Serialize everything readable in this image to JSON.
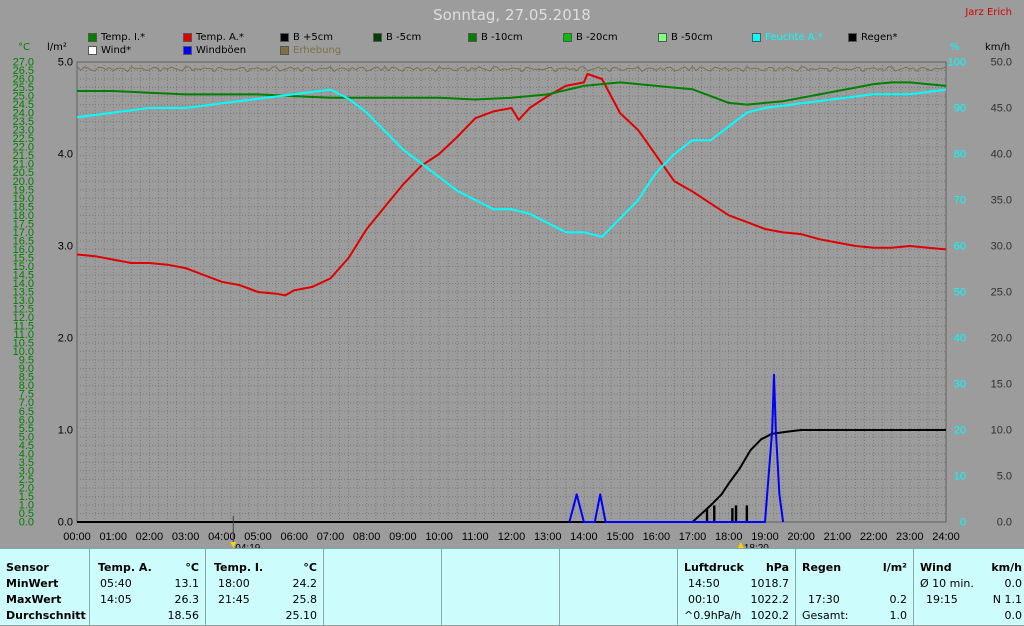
{
  "title": "Sonntag, 27.05.2018",
  "author": "Jarz Erich",
  "legend": [
    {
      "label": "Temp. I.*",
      "color": "#008000",
      "key": "temp_i"
    },
    {
      "label": "Temp. A.*",
      "color": "#e00000",
      "key": "temp_a"
    },
    {
      "label": "B +5cm",
      "color": "#000000",
      "key": "b5p"
    },
    {
      "label": "B -5cm",
      "color": "#004000",
      "key": "b5m"
    },
    {
      "label": "B -10cm",
      "color": "#008000",
      "key": "b10"
    },
    {
      "label": "B -20cm",
      "color": "#00c000",
      "key": "b20"
    },
    {
      "label": "B -50cm",
      "color": "#80ff80",
      "key": "b50"
    },
    {
      "label": "Feuchte A.*",
      "color": "#00ffff",
      "key": "humidity"
    },
    {
      "label": "Regen*",
      "color": "#000000",
      "key": "rain"
    },
    {
      "label": "Wind*",
      "color": "#ffffff",
      "key": "wind"
    },
    {
      "label": "Windböen",
      "color": "#0000ff",
      "key": "gust"
    },
    {
      "label": "Erhebung",
      "color": "#807048",
      "key": "erhebung"
    }
  ],
  "axis_units": {
    "left_temp": "°C",
    "left_rain": "l/m²",
    "right_hum": "%",
    "right_wind": "km/h"
  },
  "markers": {
    "sunrise": "04:19",
    "sunset": "18:20"
  },
  "colors": {
    "background": "#9c9c9c",
    "grid": "#7a7a7a",
    "panel": "#ccfcfc",
    "temp_left_axis": "#008000",
    "hum_axis": "#00ffff",
    "wind_axis": "#303030"
  },
  "chart_data": {
    "type": "line",
    "x_ticks": [
      "00:00",
      "01:00",
      "02:00",
      "03:00",
      "04:00",
      "05:00",
      "06:00",
      "07:00",
      "08:00",
      "09:00",
      "10:00",
      "11:00",
      "12:00",
      "13:00",
      "14:00",
      "15:00",
      "16:00",
      "17:00",
      "18:00",
      "19:00",
      "20:00",
      "21:00",
      "22:00",
      "23:00",
      "24:00"
    ],
    "xlim": [
      0,
      24
    ],
    "y_temp_ticks": [
      "0.0",
      "0.5",
      "1.0",
      "1.5",
      "2.0",
      "2.5",
      "3.0",
      "3.5",
      "4.0",
      "4.5",
      "5.0",
      "5.5",
      "6.0",
      "6.5",
      "7.0",
      "7.5",
      "8.0",
      "8.5",
      "9.0",
      "9.5",
      "10.0",
      "10.5",
      "11.0",
      "11.5",
      "12.0",
      "12.5",
      "13.0",
      "13.5",
      "14.0",
      "14.5",
      "15.0",
      "15.5",
      "16.0",
      "16.5",
      "17.0",
      "17.5",
      "18.0",
      "18.5",
      "19.0",
      "19.5",
      "20.0",
      "20.5",
      "21.0",
      "21.5",
      "22.0",
      "22.5",
      "23.0",
      "23.5",
      "24.0",
      "24.5",
      "25.0",
      "25.5",
      "26.0",
      "26.5",
      "27.0"
    ],
    "ylim_temp": [
      0,
      27
    ],
    "y_rain_ticks": [
      "0.0",
      "1.0",
      "2.0",
      "3.0",
      "4.0",
      "5.0"
    ],
    "ylim_rain": [
      0,
      5
    ],
    "y_hum_ticks": [
      "0",
      "10",
      "20",
      "30",
      "40",
      "50",
      "60",
      "70",
      "80",
      "90",
      "100"
    ],
    "ylim_hum": [
      0,
      100
    ],
    "y_wind_ticks": [
      "0.0",
      "5.0",
      "10.0",
      "15.0",
      "20.0",
      "25.0",
      "30.0",
      "35.0",
      "40.0",
      "45.0",
      "50.0"
    ],
    "ylim_wind": [
      0,
      50
    ],
    "series": [
      {
        "name": "Temp. A.*",
        "axis": "temp",
        "color": "#e00000",
        "x": [
          0,
          0.5,
          1,
          1.5,
          2,
          2.5,
          3,
          3.5,
          4,
          4.5,
          5,
          5.5,
          5.75,
          6,
          6.5,
          7,
          7.5,
          8,
          8.5,
          9,
          9.5,
          10,
          10.5,
          11,
          11.5,
          12,
          12.2,
          12.5,
          13,
          13.5,
          14,
          14.1,
          14.5,
          15,
          15.5,
          16,
          16.5,
          17,
          17.5,
          18,
          18.5,
          19,
          19.5,
          20,
          20.5,
          21,
          21.5,
          22,
          22.5,
          23,
          23.5,
          24
        ],
        "y": [
          15.7,
          15.6,
          15.4,
          15.2,
          15.2,
          15.1,
          14.9,
          14.5,
          14.1,
          13.9,
          13.5,
          13.4,
          13.3,
          13.6,
          13.8,
          14.3,
          15.5,
          17.2,
          18.5,
          19.8,
          20.9,
          21.6,
          22.6,
          23.7,
          24.1,
          24.3,
          23.6,
          24.3,
          25.0,
          25.6,
          25.8,
          26.3,
          26.0,
          24.0,
          23.0,
          21.5,
          20.0,
          19.4,
          18.7,
          18.0,
          17.6,
          17.2,
          17.0,
          16.9,
          16.6,
          16.4,
          16.2,
          16.1,
          16.1,
          16.2,
          16.1,
          16.0
        ]
      },
      {
        "name": "Temp. I.*",
        "axis": "temp",
        "color": "#008000",
        "x": [
          0,
          1,
          2,
          3,
          4,
          5,
          6,
          7,
          8,
          9,
          10,
          11,
          12,
          13,
          14,
          14.5,
          15,
          15.5,
          16,
          16.5,
          17,
          17.5,
          18,
          18.5,
          19,
          19.5,
          20,
          20.5,
          21,
          21.5,
          22,
          22.5,
          23,
          23.5,
          24
        ],
        "y": [
          25.3,
          25.3,
          25.2,
          25.1,
          25.1,
          25.1,
          25.0,
          24.9,
          24.9,
          24.9,
          24.9,
          24.8,
          24.9,
          25.1,
          25.6,
          25.7,
          25.8,
          25.7,
          25.6,
          25.5,
          25.4,
          25.0,
          24.6,
          24.5,
          24.6,
          24.7,
          24.9,
          25.1,
          25.3,
          25.5,
          25.7,
          25.8,
          25.8,
          25.7,
          25.6
        ]
      },
      {
        "name": "Feuchte A.*",
        "axis": "hum",
        "color": "#00ffff",
        "x": [
          0,
          1,
          2,
          3,
          4,
          5,
          6,
          7,
          7.5,
          8,
          8.5,
          9,
          9.5,
          10,
          10.5,
          11,
          11.5,
          12,
          12.5,
          13,
          13.5,
          14,
          14.5,
          15,
          15.5,
          16,
          16.5,
          17,
          17.5,
          18,
          18.5,
          19,
          20,
          21,
          22,
          23,
          24
        ],
        "y": [
          88,
          89,
          90,
          90,
          91,
          92,
          93,
          94,
          92,
          89,
          85,
          81,
          78,
          75,
          72,
          70,
          68,
          68,
          67,
          65,
          63,
          63,
          62,
          66,
          70,
          76,
          80,
          83,
          83,
          86,
          89,
          90,
          91,
          92,
          93,
          93,
          94
        ]
      },
      {
        "name": "Regen*",
        "axis": "rain",
        "color": "#000000",
        "x": [
          0,
          17,
          17.5,
          17.8,
          18,
          18.3,
          18.6,
          18.9,
          19.2,
          19.6,
          20,
          21,
          22,
          23,
          24
        ],
        "y": [
          0,
          0,
          0.18,
          0.3,
          0.42,
          0.58,
          0.78,
          0.9,
          0.96,
          0.98,
          1.0,
          1.0,
          1.0,
          1.0,
          1.0
        ]
      },
      {
        "name": "Windböen",
        "axis": "wind",
        "color": "#0000ff",
        "x": [
          13.6,
          13.8,
          14.0,
          14.3,
          14.45,
          14.6,
          19.0,
          19.1,
          19.2,
          19.25,
          19.3,
          19.4,
          19.5
        ],
        "y": [
          0,
          3.0,
          0,
          0,
          3.0,
          0,
          0,
          5.0,
          10.0,
          16.0,
          10.0,
          3.0,
          0
        ]
      },
      {
        "name": "Erhebung",
        "axis": "rain",
        "color": "#807048",
        "x": [
          0,
          24
        ],
        "y": [
          4.95,
          4.95
        ]
      }
    ],
    "rain_bars": {
      "x": [
        17.4,
        17.6,
        18.1,
        18.2,
        18.5
      ],
      "y": [
        0.15,
        0.18,
        0.15,
        0.18,
        0.18
      ]
    }
  },
  "panel": {
    "sensor": {
      "header": "Sensor",
      "rows": [
        "MinWert",
        "MaxWert",
        "Durchschnitt"
      ]
    },
    "temp_a": {
      "header": "Temp. A.",
      "unit": "°C",
      "min_time": "05:40",
      "min_val": "13.1",
      "max_time": "14:05",
      "max_val": "26.3",
      "avg": "18.56"
    },
    "temp_i": {
      "header": "Temp. I.",
      "unit": "°C",
      "min_time": "18:00",
      "min_val": "24.2",
      "max_time": "21:45",
      "max_val": "25.8",
      "avg": "25.10"
    },
    "pressure": {
      "header": "Luftdruck",
      "unit": "hPa",
      "min_time": "14:50",
      "min_val": "1018.7",
      "max_time": "00:10",
      "max_val": "1022.2",
      "trend": "^0.9hPa/h",
      "current": "1020.2"
    },
    "rain": {
      "header": "Regen",
      "unit": "l/m²",
      "time": "17:30",
      "val": "0.2",
      "total_label": "Gesamt:",
      "total": "1.0"
    },
    "wind": {
      "header": "Wind",
      "unit": "km/h",
      "avg_label": "Ø 10 min.",
      "avg": "0.0",
      "max_time": "19:15",
      "max_val": "N 1.1",
      "current": "0.0"
    }
  }
}
